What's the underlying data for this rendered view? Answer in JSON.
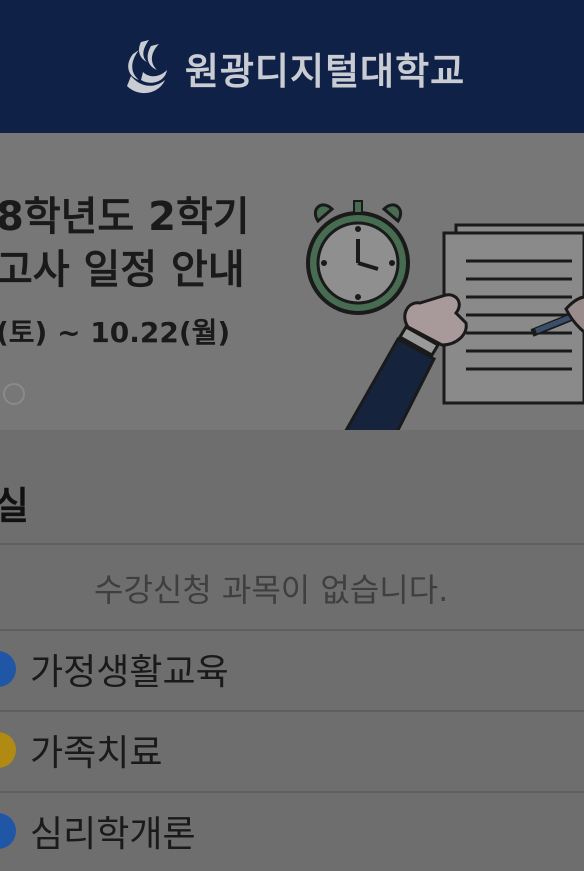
{
  "header": {
    "university_name": "원광디지털대학교"
  },
  "banner": {
    "title_line1": "8학년도 2학기",
    "title_line2": "고사 일정 안내",
    "date_range": "(토) ~ 10.22(월)"
  },
  "section": {
    "title": "실",
    "empty_message": "수강신청 과목이 없습니다.",
    "courses": [
      {
        "name": "가정생활교육",
        "color": "#1f56a6"
      },
      {
        "name": "가족치료",
        "color": "#b08a12"
      },
      {
        "name": "심리학개론",
        "color": "#1f56a6"
      }
    ]
  }
}
